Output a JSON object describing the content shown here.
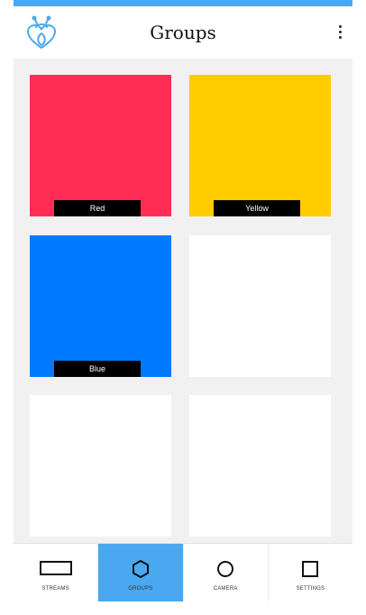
{
  "app": {
    "accent_color": "#4aa8f0",
    "logo_icon": "bug-heart-logo",
    "title": "Groups",
    "menu_icon": "more-vertical-icon"
  },
  "groups": [
    {
      "label": "Red",
      "color": "#ff2d55"
    },
    {
      "label": "Yellow",
      "color": "#ffcc00"
    },
    {
      "label": "Blue",
      "color": "#007aff"
    },
    {
      "label": "",
      "color": "#ffffff"
    },
    {
      "label": "",
      "color": "#ffffff"
    },
    {
      "label": "",
      "color": "#ffffff"
    }
  ],
  "tabs": [
    {
      "label": "STREAMS",
      "icon": "rectangle-icon",
      "active": false
    },
    {
      "label": "GROUPS",
      "icon": "hexagon-icon",
      "active": true
    },
    {
      "label": "CAMERA",
      "icon": "circle-icon",
      "active": false
    },
    {
      "label": "SETTINGS",
      "icon": "square-icon",
      "active": false
    }
  ]
}
